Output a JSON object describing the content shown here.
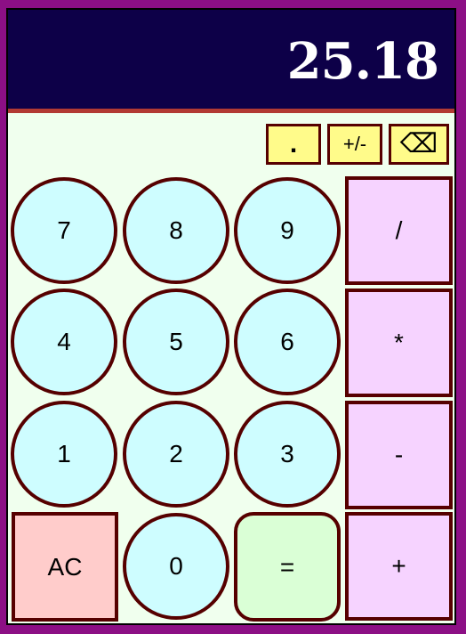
{
  "display": {
    "value": "25.18"
  },
  "top_buttons": {
    "decimal": ".",
    "sign": "+/-",
    "backspace": "⌫"
  },
  "digits": {
    "d7": "7",
    "d8": "8",
    "d9": "9",
    "d4": "4",
    "d5": "5",
    "d6": "6",
    "d1": "1",
    "d2": "2",
    "d3": "3",
    "d0": "0"
  },
  "operators": {
    "divide": "/",
    "multiply": "*",
    "subtract": "-",
    "add": "+"
  },
  "actions": {
    "clear": "AC",
    "equals": "="
  },
  "colors": {
    "frame": "#8c0f85",
    "display_bg": "#0d0048",
    "display_rule": "#b23a33",
    "body_bg": "#f0ffee",
    "digit_bg": "#cefdff",
    "operator_bg": "#f6d3ff",
    "clear_bg": "#ffcccb",
    "equals_bg": "#daffd6",
    "top_button_bg": "#fffb8a",
    "border": "#560000"
  }
}
